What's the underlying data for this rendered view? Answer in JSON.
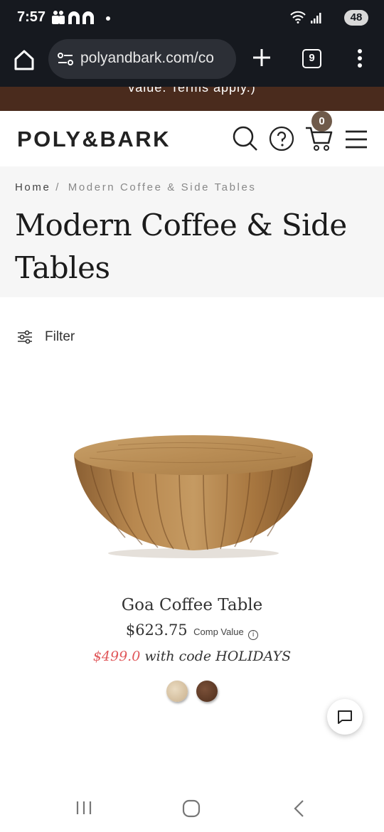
{
  "status_bar": {
    "time": "7:57",
    "battery": "48",
    "icons": [
      "app-icon",
      "app-icon",
      "notification-dot-icon",
      "wifi-icon",
      "signal-icon",
      "battery-icon"
    ]
  },
  "browser": {
    "url": "polyandbark.com/co",
    "tab_count": "9",
    "icons": [
      "home-icon",
      "site-settings-icon",
      "plus-icon",
      "tabs-icon",
      "more-vert-icon"
    ]
  },
  "promo_banner": {
    "text": "value. Terms apply.)"
  },
  "header": {
    "logo": "POLY&BARK",
    "cart_count": "0",
    "icons": [
      "search-icon",
      "help-icon",
      "cart-icon",
      "hamburger-menu-icon"
    ]
  },
  "breadcrumb": {
    "home": "Home",
    "separator": "/",
    "current": "Modern Coffee & Side Tables"
  },
  "page_title": "Modern Coffee & Side Tables",
  "filter": {
    "label": "Filter",
    "icon": "sliders-icon"
  },
  "product": {
    "name": "Goa Coffee Table",
    "price": "$623.75",
    "comp_value_label": "Comp Value",
    "sale_price": "$499.0",
    "code_text": "with code HOLIDAYS",
    "swatches": [
      {
        "color": "#d9c6a6"
      },
      {
        "color": "#5e3a25"
      }
    ],
    "colors": {
      "sale": "#e0575a"
    }
  },
  "chat": {
    "icon": "chat-bubble-icon"
  },
  "nav": {
    "icons": [
      "recents-icon",
      "home-circle-icon",
      "back-icon"
    ]
  }
}
